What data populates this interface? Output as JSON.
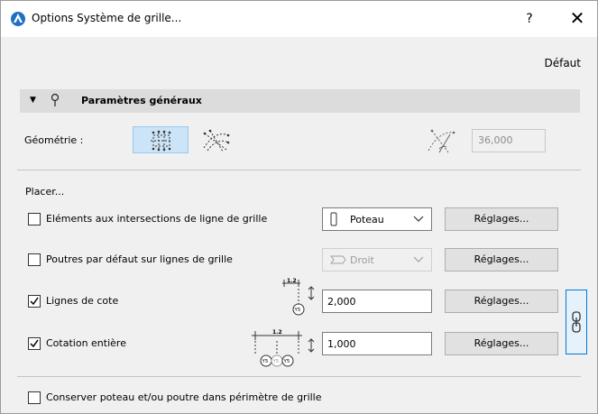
{
  "window": {
    "title": "Options Système de grille...",
    "help_label": "?",
    "close_label": "✕"
  },
  "toolbar": {
    "default_label": "Défaut"
  },
  "general": {
    "header_label": "Paramètres généraux",
    "geometry_label": "Géométrie :",
    "angle_value": "36,000"
  },
  "placer": {
    "label": "Placer...",
    "rows": [
      {
        "label": "Eléments aux intersections de ligne de grille",
        "checked": false,
        "control": "Poteau",
        "button": "Réglages..."
      },
      {
        "label": "Poutres par défaut sur lignes de grille",
        "checked": false,
        "control": "Droit",
        "button": "Réglages...",
        "disabled": true
      },
      {
        "label": "Lignes de cote",
        "checked": true,
        "control": "2,000",
        "button": "Réglages...",
        "dim_value": "1.2",
        "marker": "Y5"
      },
      {
        "label": "Cotation entière",
        "checked": true,
        "control": "1,000",
        "button": "Réglages...",
        "dim_value": "1.2",
        "markers": [
          "Y5",
          "Y5",
          "Y5"
        ]
      }
    ]
  },
  "footer": {
    "keep_label": "Conserver poteau et/ou poutre dans périmètre de grille",
    "keep_checked": false
  },
  "icons": {
    "app": "archicad-logo-icon",
    "pin": "pin-icon",
    "link": "chain-link-icon"
  },
  "colors": {
    "accent": "#0078d7",
    "selected_bg": "#cce4f7",
    "section_bg": "#dcdcdc"
  }
}
